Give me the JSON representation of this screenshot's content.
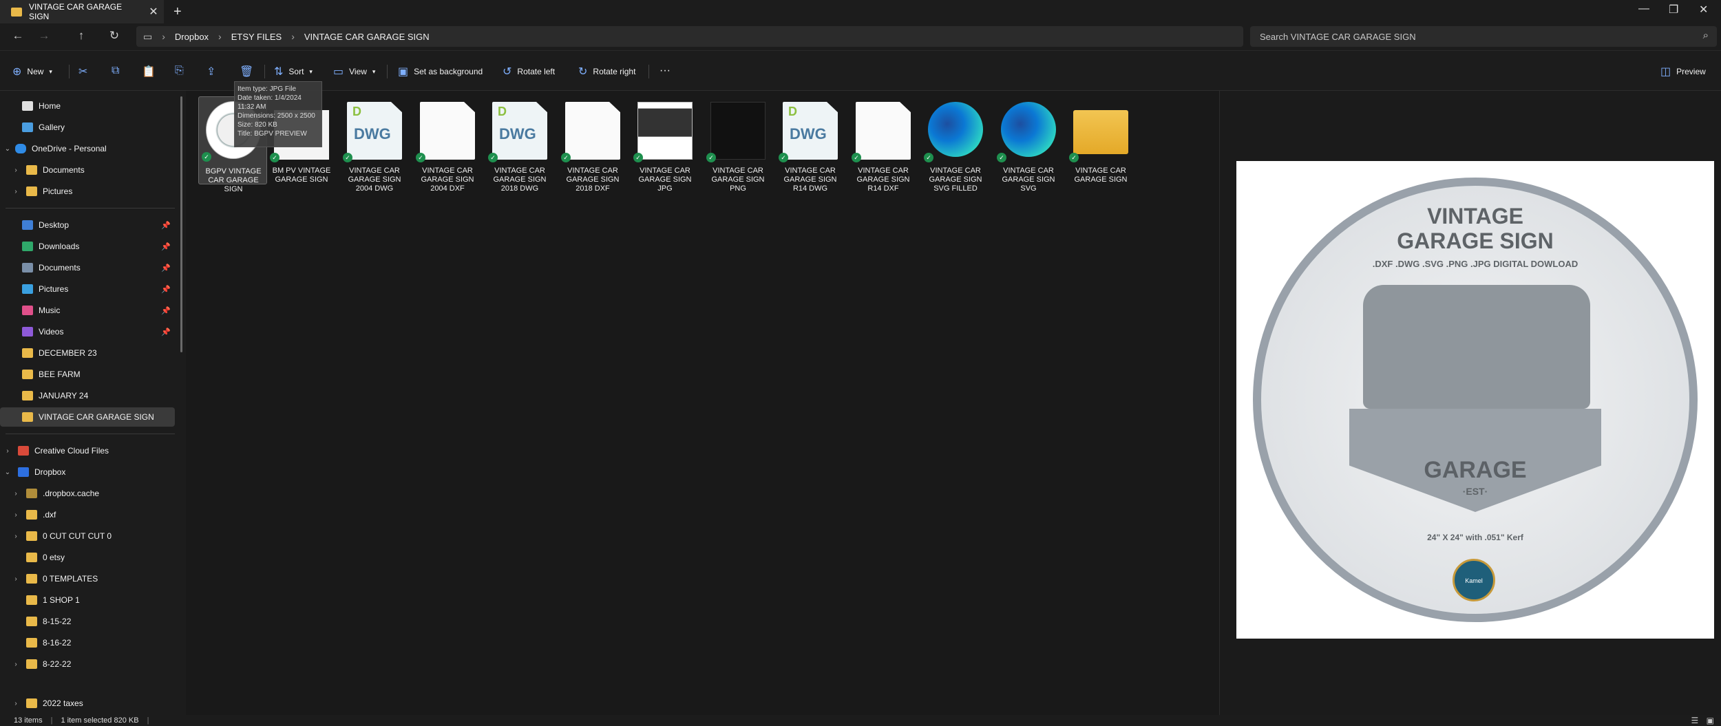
{
  "window": {
    "tab_title": "VINTAGE CAR GARAGE SIGN"
  },
  "nav": {
    "breadcrumb": [
      "Dropbox",
      "ETSY FILES",
      "VINTAGE CAR GARAGE SIGN"
    ],
    "search_placeholder": "Search VINTAGE CAR GARAGE SIGN"
  },
  "toolbar": {
    "new": "New",
    "sort": "Sort",
    "view": "View",
    "set_background": "Set as background",
    "rotate_left": "Rotate left",
    "rotate_right": "Rotate right",
    "more": "···",
    "preview": "Preview"
  },
  "sidebar": {
    "items": [
      {
        "label": "Home"
      },
      {
        "label": "Gallery"
      },
      {
        "label": "OneDrive - Personal"
      },
      {
        "label": "Documents"
      },
      {
        "label": "Pictures"
      },
      {
        "label": "Desktop"
      },
      {
        "label": "Downloads"
      },
      {
        "label": "Documents"
      },
      {
        "label": "Pictures"
      },
      {
        "label": "Music"
      },
      {
        "label": "Videos"
      },
      {
        "label": "DECEMBER 23"
      },
      {
        "label": "BEE FARM"
      },
      {
        "label": "JANUARY 24"
      },
      {
        "label": "VINTAGE CAR GARAGE SIGN"
      },
      {
        "label": "Creative Cloud Files"
      },
      {
        "label": "Dropbox"
      },
      {
        "label": ".dropbox.cache"
      },
      {
        "label": ".dxf"
      },
      {
        "label": "0 CUT CUT CUT 0"
      },
      {
        "label": "0 etsy"
      },
      {
        "label": "0 TEMPLATES"
      },
      {
        "label": "1 SHOP 1"
      },
      {
        "label": "8-15-22"
      },
      {
        "label": "8-16-22"
      },
      {
        "label": "8-22-22"
      },
      {
        "label": "2022 taxes"
      }
    ]
  },
  "files": [
    {
      "name": "BGPV VINTAGE CAR GARAGE SIGN"
    },
    {
      "name": "BM PV VINTAGE GARAGE SIGN"
    },
    {
      "name": "VINTAGE CAR GARAGE SIGN 2004 DWG"
    },
    {
      "name": "VINTAGE CAR GARAGE SIGN 2004 DXF"
    },
    {
      "name": "VINTAGE CAR GARAGE SIGN 2018 DWG"
    },
    {
      "name": "VINTAGE CAR GARAGE SIGN 2018 DXF"
    },
    {
      "name": "VINTAGE CAR GARAGE SIGN JPG"
    },
    {
      "name": "VINTAGE CAR GARAGE SIGN PNG"
    },
    {
      "name": "VINTAGE CAR GARAGE SIGN R14 DWG"
    },
    {
      "name": "VINTAGE CAR GARAGE SIGN R14 DXF"
    },
    {
      "name": "VINTAGE CAR GARAGE SIGN SVG FILLED"
    },
    {
      "name": "VINTAGE CAR GARAGE SIGN SVG"
    },
    {
      "name": "VINTAGE CAR GARAGE SIGN"
    }
  ],
  "tooltip": {
    "type": "Item type: JPG File",
    "date": "Date taken: 1/4/2024 11:32 AM",
    "dims": "Dimensions: 2500 x 2500",
    "size": "Size: 820 KB",
    "title": "Title: BGPV PREVIEW"
  },
  "preview_image": {
    "title1": "VINTAGE",
    "title2": "GARAGE SIGN",
    "formats": ".DXF .DWG .SVG .PNG .JPG DIGITAL DOWLOAD",
    "garage": "GARAGE",
    "est": "·EST·",
    "size": "24\" X 24\" with .051\" Kerf",
    "badge": "Kamel"
  },
  "status": {
    "count": "13 items",
    "selected": "1 item selected  820 KB"
  }
}
